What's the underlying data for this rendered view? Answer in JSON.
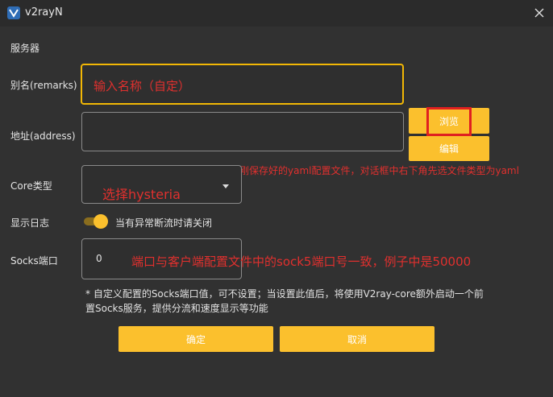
{
  "window": {
    "title": "v2rayN",
    "close_glyph": "✕"
  },
  "form": {
    "section_title": "服务器",
    "remarks_label": "别名(remarks)",
    "address_label": "地址(address)",
    "core_type_label": "Core类型",
    "show_log_label": "显示日志",
    "show_log_toggle_text": "当有异常断流时请关闭",
    "show_log_on": true,
    "socks_port_label": "Socks端口",
    "socks_port_value": "0",
    "note_line1": "* 自定义配置的Socks端口值，可不设置；当设置此值后，将使用V2ray-core额外启动一个前",
    "note_line2": "置Socks服务，提供分流和速度显示等功能"
  },
  "buttons": {
    "browse": "浏览",
    "edit": "编辑",
    "ok": "确定",
    "cancel": "取消"
  },
  "annotations": {
    "remarks_hint": "输入名称（自定）",
    "browse_hint": "点击浏览，选择刚刚保存好的yaml配置文件，对话框中右下角先选文件类型为yaml",
    "core_hint": "选择hysteria",
    "socks_hint": "端口与客户端配置文件中的sock5端口号一致，例子中是50000"
  },
  "colors": {
    "accent": "#fbc02d",
    "annotation": "#e0302e",
    "background": "#313131"
  },
  "icons": {
    "app": "v2rayn-logo-icon",
    "close": "close-icon",
    "dropdown": "caret-down-icon"
  }
}
